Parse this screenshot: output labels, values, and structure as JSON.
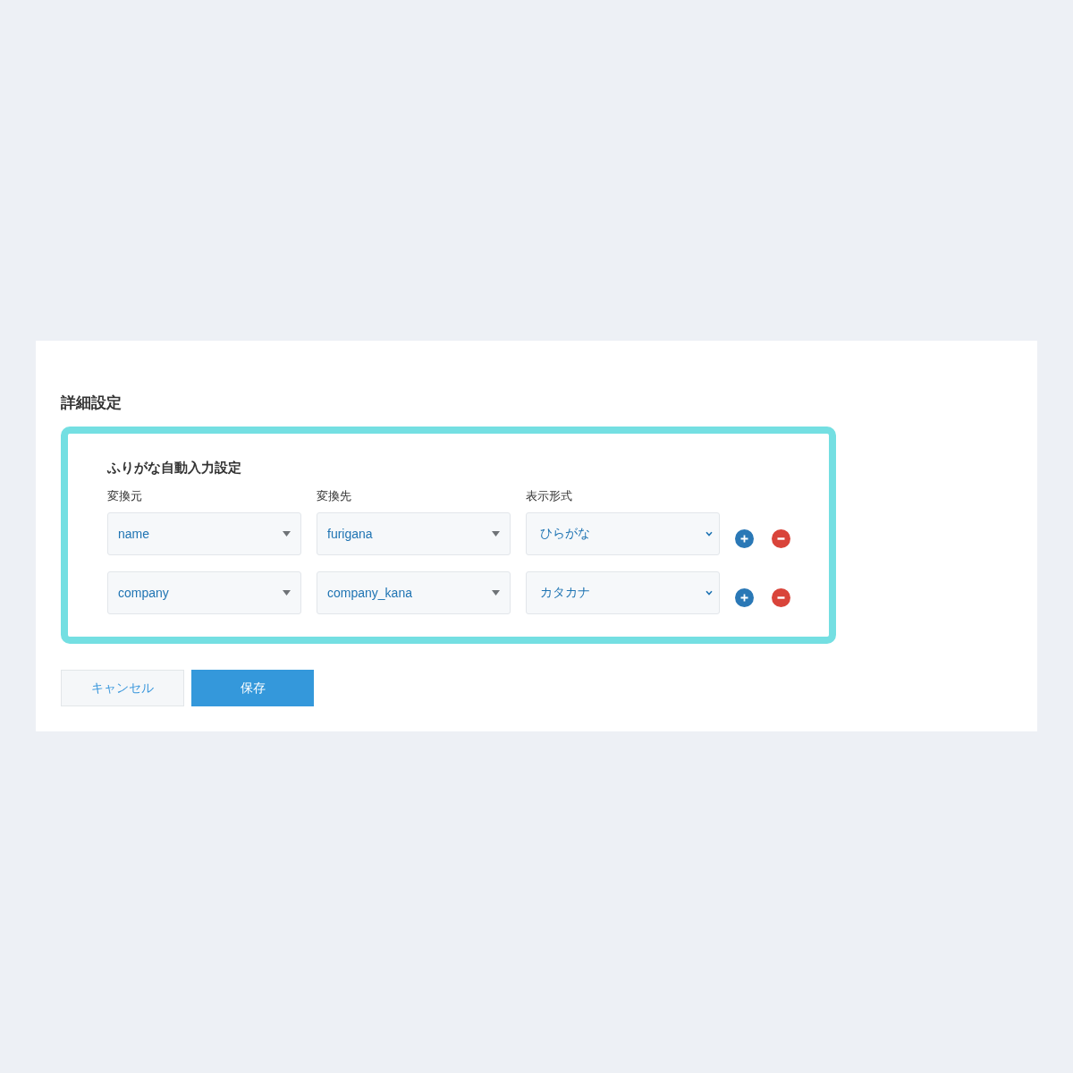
{
  "section": {
    "title": "詳細設定"
  },
  "furigana_settings": {
    "title": "ふりがな自動入力設定",
    "columns": [
      "変換元",
      "変換先",
      "表示形式"
    ],
    "rows": [
      {
        "fields": [
          {
            "kind": "combobox",
            "value": "name"
          },
          {
            "kind": "combobox",
            "value": "furigana"
          },
          {
            "kind": "select",
            "value": "ひらがな"
          }
        ]
      },
      {
        "fields": [
          {
            "kind": "combobox",
            "value": "company"
          },
          {
            "kind": "combobox",
            "value": "company_kana"
          },
          {
            "kind": "select",
            "value": "カタカナ"
          }
        ]
      }
    ]
  },
  "buttons": [
    {
      "kind": "secondary",
      "label": "キャンセル"
    },
    {
      "kind": "primary",
      "label": "保存"
    }
  ]
}
